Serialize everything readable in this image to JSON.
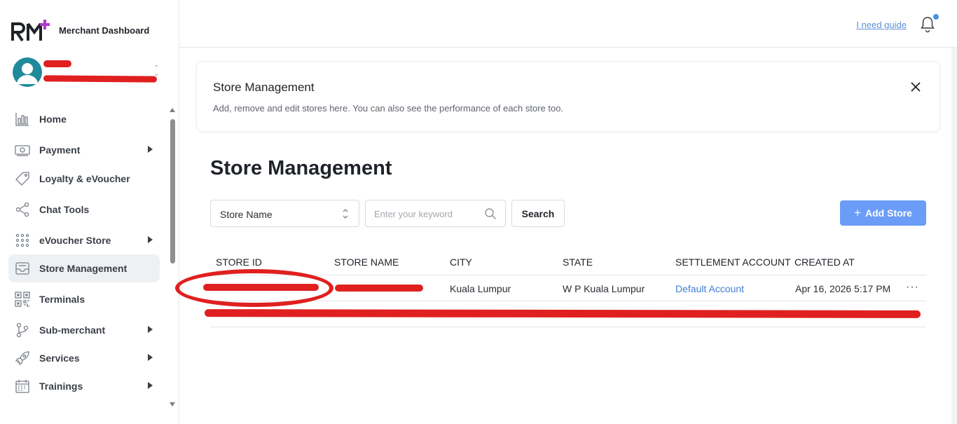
{
  "brand": {
    "title": "Merchant Dashboard"
  },
  "sidebar": {
    "items": [
      {
        "label": "Home",
        "icon": "bar-chart-icon",
        "has_submenu": false,
        "active": false
      },
      {
        "label": "Payment",
        "icon": "cash-icon",
        "has_submenu": true,
        "active": false
      },
      {
        "label": "Loyalty & eVoucher",
        "icon": "tag-icon",
        "has_submenu": false,
        "active": false
      },
      {
        "label": "Chat Tools",
        "icon": "share-icon",
        "has_submenu": false,
        "active": false
      },
      {
        "label": "eVoucher Store",
        "icon": "grid-dots-icon",
        "has_submenu": true,
        "active": false
      },
      {
        "label": "Store Management",
        "icon": "inbox-icon",
        "has_submenu": false,
        "active": true
      },
      {
        "label": "Terminals",
        "icon": "qr-code-icon",
        "has_submenu": false,
        "active": false
      },
      {
        "label": "Sub-merchant",
        "icon": "branch-icon",
        "has_submenu": true,
        "active": false
      },
      {
        "label": "Services",
        "icon": "rocket-icon",
        "has_submenu": true,
        "active": false
      },
      {
        "label": "Trainings",
        "icon": "calendar-icon",
        "has_submenu": true,
        "active": false
      }
    ]
  },
  "header": {
    "guide_label": "I need guide"
  },
  "info_card": {
    "title": "Store Management",
    "description": "Add, remove and edit stores here. You can also see the performance of each store too."
  },
  "page": {
    "title": "Store Management"
  },
  "filters": {
    "field_select": "Store Name",
    "keyword_placeholder": "Enter your keyword",
    "search_label": "Search",
    "add_label": "Add Store"
  },
  "table": {
    "columns": [
      "STORE ID",
      "STORE NAME",
      "CITY",
      "STATE",
      "SETTLEMENT ACCOUNT",
      "CREATED AT"
    ],
    "rows": [
      {
        "store_id": "",
        "store_name": "",
        "city": "Kuala Lumpur",
        "state": "W P Kuala Lumpur",
        "settlement_account": "Default Account",
        "created_at": "Apr 16, 2026 5:17 PM"
      },
      {
        "store_id": "",
        "store_name": "",
        "city": "",
        "state": "",
        "settlement_account": "",
        "created_at": ""
      }
    ]
  },
  "colors": {
    "accent": "#6b9cf7",
    "link": "#3f7fd8",
    "redaction": "#e02020"
  }
}
